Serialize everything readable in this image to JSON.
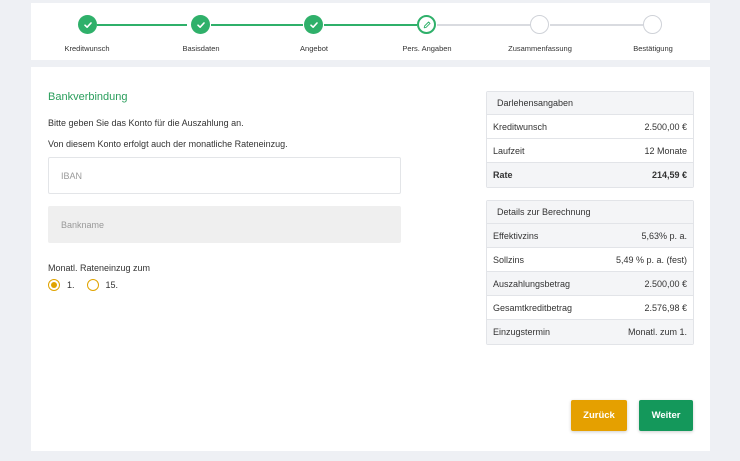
{
  "colors": {
    "accent_green": "#2fb06a",
    "section_title": "#2a9e5c",
    "back_button": "#e5a000",
    "next_button": "#14985b",
    "radio_accent": "#e0a300"
  },
  "stepper": {
    "steps": [
      {
        "label": "Kreditwunsch",
        "state": "done",
        "icon": "check-icon"
      },
      {
        "label": "Basisdaten",
        "state": "done",
        "icon": "check-icon"
      },
      {
        "label": "Angebot",
        "state": "done",
        "icon": "check-icon"
      },
      {
        "label": "Pers. Angaben",
        "state": "active",
        "icon": "pencil-icon"
      },
      {
        "label": "Zusammenfassung",
        "state": "todo",
        "icon": ""
      },
      {
        "label": "Bestätigung",
        "state": "todo",
        "icon": ""
      }
    ]
  },
  "form": {
    "title": "Bankverbindung",
    "intro1": "Bitte geben Sie das Konto für die Auszahlung an.",
    "intro2": "Von diesem Konto erfolgt auch der monatliche Rateneinzug.",
    "iban_placeholder": "IBAN",
    "iban_value": "",
    "bankname_placeholder": "Bankname",
    "bankname_value": "",
    "rateneinzug_label": "Monatl. Rateneinzug zum",
    "options": [
      {
        "label": "1.",
        "selected": true
      },
      {
        "label": "15.",
        "selected": false
      }
    ]
  },
  "darlehen": {
    "title": "Darlehensangaben",
    "rows": [
      {
        "label": "Kreditwunsch",
        "value": "2.500,00 €"
      },
      {
        "label": "Laufzeit",
        "value": "12 Monate"
      },
      {
        "label": "Rate",
        "value": "214,59 €"
      }
    ]
  },
  "details": {
    "title": "Details zur Berechnung",
    "rows": [
      {
        "label": "Effektivzins",
        "value": "5,63% p. a."
      },
      {
        "label": "Sollzins",
        "value": "5,49 % p. a. (fest)"
      },
      {
        "label": "Auszahlungsbetrag",
        "value": "2.500,00 €"
      },
      {
        "label": "Gesamtkreditbetrag",
        "value": "2.576,98 €"
      },
      {
        "label": "Einzugstermin",
        "value": "Monatl. zum 1."
      }
    ]
  },
  "buttons": {
    "back": "Zurück",
    "next": "Weiter"
  }
}
